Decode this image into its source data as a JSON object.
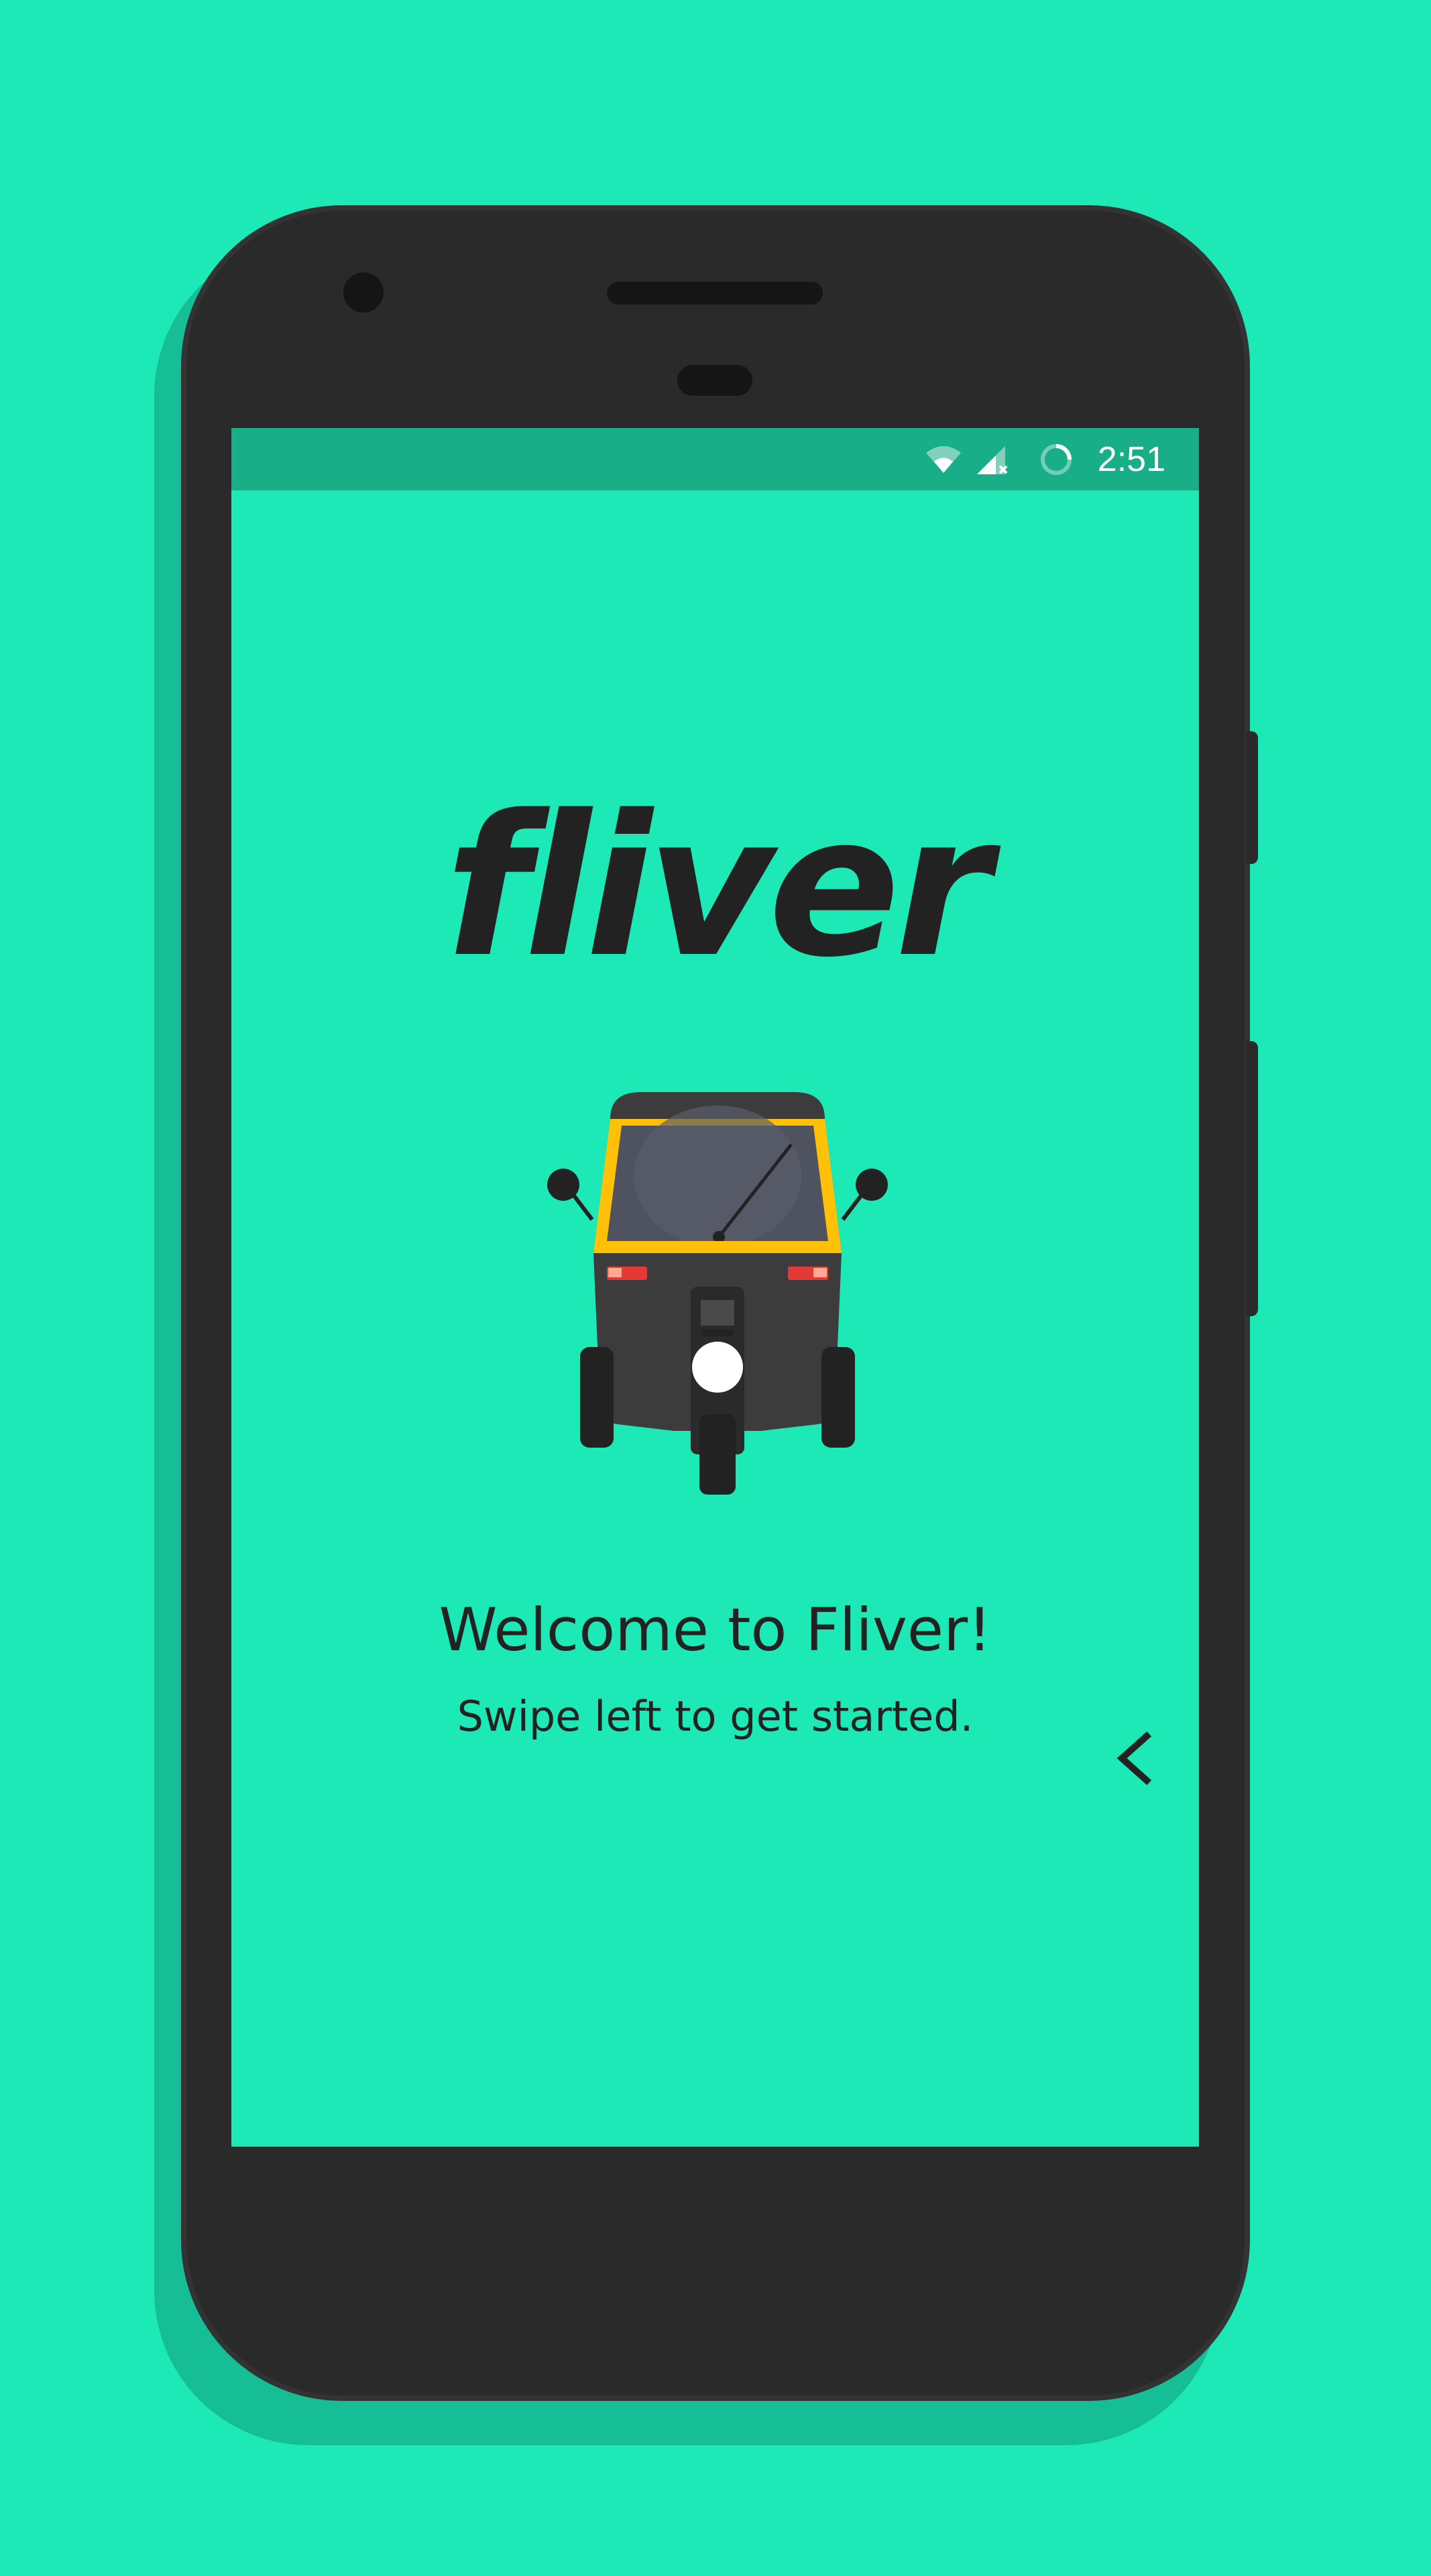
{
  "status_bar": {
    "time": "2:51",
    "icons": [
      "wifi-icon",
      "cell-signal-no-data-icon",
      "loading-spinner-icon"
    ]
  },
  "onboarding": {
    "logo_text": "fliver",
    "title": "Welcome to Fliver!",
    "subtitle": "Swipe left to get started.",
    "next_icon": "chevron-left-icon"
  },
  "colors": {
    "background": "#1DE9B6",
    "status_bar": "#18AE88",
    "phone_body": "#2A2A2A",
    "text": "#222222",
    "rickshaw_yellow": "#FFC107"
  }
}
